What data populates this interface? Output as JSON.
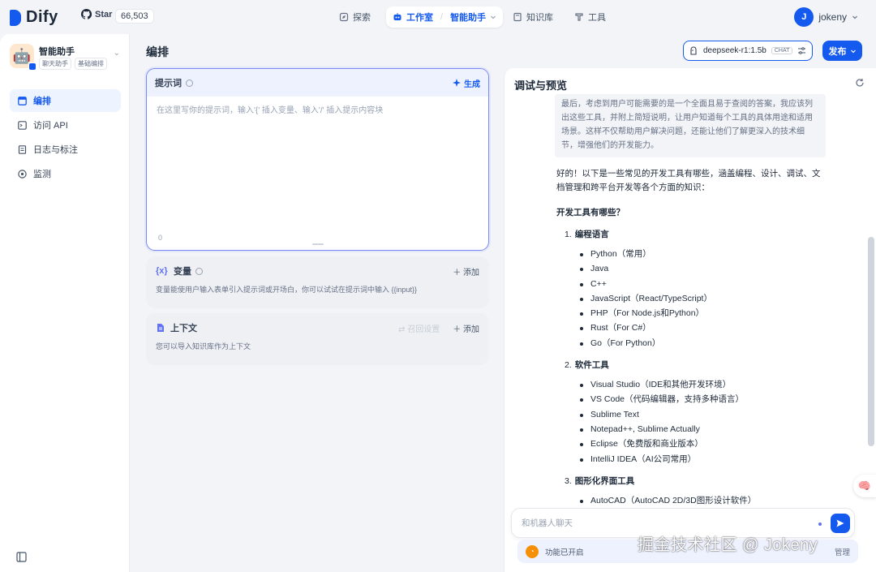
{
  "brand": {
    "name": "Dify",
    "github_label": "Star",
    "github_stars": "66,503"
  },
  "nav": {
    "explore": "探索",
    "studio": "工作室",
    "studio_app": "智能助手",
    "knowledge": "知识库",
    "tools": "工具"
  },
  "user": {
    "initial": "J",
    "name": "jokeny"
  },
  "app": {
    "name": "智能助手",
    "tags": [
      "聊天助手",
      "基础编排"
    ]
  },
  "sidebar": {
    "items": [
      {
        "label": "编排",
        "icon": "layout-icon",
        "active": true
      },
      {
        "label": "访问 API",
        "icon": "terminal-icon",
        "active": false
      },
      {
        "label": "日志与标注",
        "icon": "document-icon",
        "active": false
      },
      {
        "label": "监测",
        "icon": "monitor-icon",
        "active": false
      }
    ]
  },
  "editor": {
    "title": "编排",
    "prompt": {
      "label": "提示词",
      "generate_label": "生成",
      "placeholder": "在这里写你的提示词，输入'{' 插入变量、输入'/' 插入提示内容块",
      "count": "0"
    },
    "variables": {
      "icon": "{x}",
      "title": "变量",
      "add_label": "添加",
      "description": "变量能使用户输入表单引入提示词或开场白，你可以试试在提示词中输入 {{input}}"
    },
    "context": {
      "title": "上下文",
      "retrieval_settings": "召回设置",
      "add_label": "添加",
      "description": "您可以导入知识库作为上下文"
    }
  },
  "model": {
    "name": "deepseek-r1:1.5b",
    "mode": "CHAT"
  },
  "publish_label": "发布",
  "debug": {
    "title": "调试与预览",
    "thinking": "最后，考虑到用户可能需要的是一个全面且易于查阅的答案，我应该列出这些工具，并附上简短说明，让用户知道每个工具的具体用途和适用场景。这样不仅帮助用户解决问题，还能让他们了解更深入的技术细节，增强他们的开发能力。",
    "intro": "好的！以下是一些常见的开发工具有哪些，涵盖编程、设计、调试、文档管理和跨平台开发等各个方面的知识：",
    "heading": "开发工具有哪些？",
    "sections": [
      {
        "num": "1.",
        "title": "编程语言",
        "items": [
          "Python（常用）",
          "Java",
          "C++",
          "JavaScript（React/TypeScript）",
          "PHP（For Node.js和Python）",
          "Rust（For C#）",
          "Go（For Python）"
        ]
      },
      {
        "num": "2.",
        "title": "软件工具",
        "items": [
          "Visual Studio（IDE和其他开发环境）",
          "VS Code（代码编辑器，支持多种语言）",
          "Sublime Text",
          "Notepad++, Sublime Actually",
          "Eclipse（免费版和商业版本）",
          "IntelliJ IDEA（AI公司常用）"
        ]
      },
      {
        "num": "3.",
        "title": "图形化界面工具",
        "items": [
          "AutoCAD（AutoCAD 2D/3D图形设计软件）"
        ]
      }
    ],
    "input_placeholder": "和机器人聊天",
    "feature_text": "功能已开启",
    "feature_manage": "管理"
  },
  "watermark": "掘金技术社区 @ Jokeny",
  "colors": {
    "accent": "#155aef",
    "prompt_border": "#7a88f5"
  }
}
